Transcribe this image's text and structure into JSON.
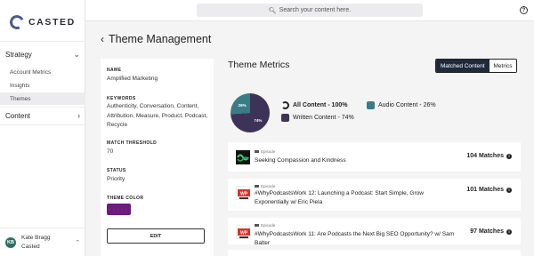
{
  "brand": {
    "name": "CASTED"
  },
  "sidebar": {
    "sections": [
      {
        "label": "Strategy",
        "chevron": "chevron-down-icon"
      },
      {
        "label": "Content",
        "chevron": "chevron-right-icon"
      }
    ],
    "items": [
      {
        "label": "Account Metrics"
      },
      {
        "label": "Insights"
      },
      {
        "label": "Themes",
        "active": true
      }
    ],
    "user": {
      "initials": "KB",
      "name": "Kate Bragg",
      "org": "Casted"
    }
  },
  "topbar": {
    "search_placeholder": "Search your content here.",
    "help": "?"
  },
  "page": {
    "title": "Theme Management"
  },
  "theme": {
    "name_label": "NAME",
    "name": "Amplified Marketing",
    "keywords_label": "KEYWORDS",
    "keywords": "Authenticity, Conversation, Content, Attribution, Measure, Product, Podcast, Recycle",
    "threshold_label": "MATCH THRESHOLD",
    "threshold": "70",
    "status_label": "STATUS",
    "status": "Priority",
    "color_label": "THEME COLOR",
    "color": "#6b1d7c",
    "edit_label": "EDIT"
  },
  "metrics": {
    "title": "Theme Metrics",
    "toggle": [
      {
        "label": "Matched Content",
        "active": true
      },
      {
        "label": "Metrics",
        "active": false
      }
    ],
    "legend": [
      {
        "label": "All Content - 100%"
      },
      {
        "label": "Written Content - 74%",
        "color": "#3d3358"
      },
      {
        "label": "Audio Content - 26%",
        "color": "#3a7c86"
      }
    ]
  },
  "chart_data": {
    "type": "pie",
    "categories": [
      "Written Content",
      "Audio Content"
    ],
    "values": [
      74,
      26
    ],
    "colors": [
      "#3d3358",
      "#3a7c86"
    ],
    "labels": [
      "74%",
      "26%"
    ]
  },
  "episodes": [
    {
      "tag": "Episode",
      "title": "Seeking Compassion and Kindness",
      "matches": "104 Matches"
    },
    {
      "tag": "Episode",
      "title": "#WhyPodcastsWork 12: Launching a Podcast: Start Simple, Grow Exponentially w/ Eric Piela",
      "matches": "101 Matches"
    },
    {
      "tag": "Episode",
      "title": "#WhyPodcastsWork 11: Are Podcasts the Next Big SEO Opportunity? w/ Sam Balter",
      "matches": "97 Matches"
    }
  ]
}
